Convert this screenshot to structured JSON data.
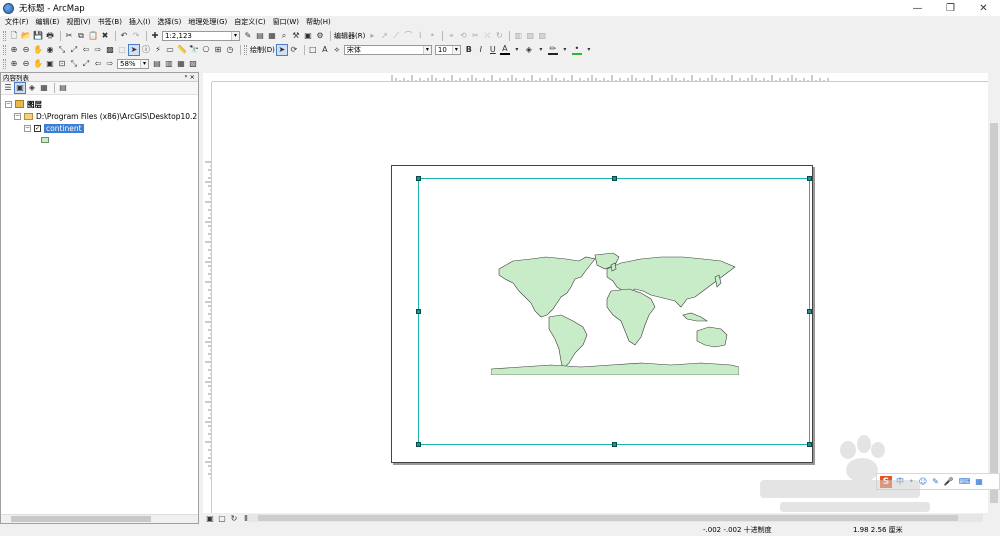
{
  "window": {
    "title": "无标题 - ArcMap",
    "controls": [
      "—",
      "❐",
      "✕"
    ]
  },
  "menu": [
    "文件(F)",
    "编辑(E)",
    "视图(V)",
    "书签(B)",
    "插入(I)",
    "选择(S)",
    "地理处理(G)",
    "自定义(C)",
    "窗口(W)",
    "帮助(H)"
  ],
  "toolbar": {
    "scale_value": "1:2,123",
    "editor_label": "编辑器(R)",
    "draw_label": "绘制(D)",
    "font_name": "宋体",
    "font_size": "10",
    "bold_label": "B",
    "italic_label": "I",
    "underline_label": "U",
    "text_color_label": "A",
    "zoom_value": "58%"
  },
  "toc": {
    "title": "内容列表",
    "header_buttons": "ᵖ ×",
    "layers_label": "图层",
    "path_label": "D:\\Program Files (x86)\\ArcGIS\\Desktop10.2",
    "layer_name": "continent"
  },
  "status": {
    "coords": "-.002  -.002 十进制度",
    "page_coords": "1.98  2.56 厘米"
  },
  "colors": {
    "land_fill": "#c8ecc8",
    "frame_border": "#1ab3b3",
    "selection_blue": "#3c7fd4"
  }
}
